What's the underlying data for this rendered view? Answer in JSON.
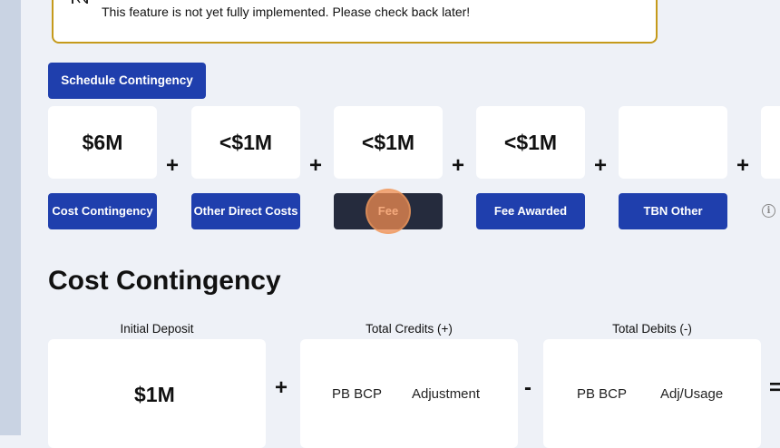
{
  "banner": {
    "message": "This feature is not yet fully implemented. Please check back later!"
  },
  "schedule_button": "Schedule Contingency",
  "cards": [
    {
      "value": "$6M",
      "label": "Cost Contingency"
    },
    {
      "value": "<$1M",
      "label": "Other Direct Costs"
    },
    {
      "value": "<$1M",
      "label": "Fee"
    },
    {
      "value": "<$1M",
      "label": "Fee Awarded"
    },
    {
      "value": "",
      "label": "TBN Other"
    }
  ],
  "operators": {
    "plus": "+",
    "minus": "-",
    "equals": "="
  },
  "section": {
    "title": "Cost Contingency",
    "initial_deposit": {
      "label": "Initial Deposit",
      "value": "$1M"
    },
    "total_credits": {
      "label": "Total Credits (+)",
      "items": [
        "PB BCP",
        "Adjustment"
      ]
    },
    "total_debits": {
      "label": "Total Debits (-)",
      "items": [
        "PB BCP",
        "Adj/Usage"
      ]
    }
  },
  "colors": {
    "primary": "#1f3fad",
    "selected": "#252b3d",
    "banner_border": "#c59a1b",
    "background": "#eef1f7"
  },
  "icons": {
    "banner": "construction-barrier-icon",
    "info": "info-icon"
  }
}
